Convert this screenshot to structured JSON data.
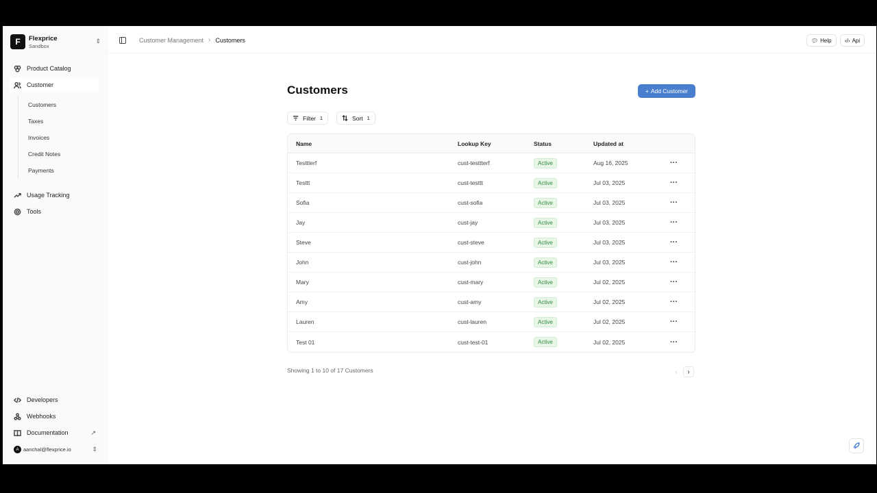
{
  "brand": {
    "initial": "F",
    "name": "Flexprice",
    "env": "Sandbox"
  },
  "nav": {
    "product_catalog": "Product Catalog",
    "customer": "Customer",
    "sub": [
      "Customers",
      "Taxes",
      "Invoices",
      "Credit Notes",
      "Payments"
    ],
    "usage_tracking": "Usage Tracking",
    "tools": "Tools",
    "developers": "Developers",
    "webhooks": "Webhooks",
    "documentation": "Documentation"
  },
  "user": {
    "initial": "A",
    "email": "aanchal@flexprice.io"
  },
  "breadcrumb": {
    "parent": "Customer Management",
    "current": "Customers"
  },
  "topbar": {
    "help": "Help",
    "api": "Api"
  },
  "page": {
    "title": "Customers",
    "add_label": "Add Customer",
    "filter_label": "Filter",
    "filter_count": "1",
    "sort_label": "Sort",
    "sort_count": "1"
  },
  "table": {
    "headers": [
      "Name",
      "Lookup Key",
      "Status",
      "Updated at"
    ],
    "rows": [
      {
        "name": "Testtterf",
        "key": "cust-testtterf",
        "status": "Active",
        "updated": "Aug 16, 2025"
      },
      {
        "name": "Testtt",
        "key": "cust-testtt",
        "status": "Active",
        "updated": "Jul 03, 2025"
      },
      {
        "name": "Sofia",
        "key": "cust-sofia",
        "status": "Active",
        "updated": "Jul 03, 2025"
      },
      {
        "name": "Jay",
        "key": "cust-jay",
        "status": "Active",
        "updated": "Jul 03, 2025"
      },
      {
        "name": "Steve",
        "key": "cust-steve",
        "status": "Active",
        "updated": "Jul 03, 2025"
      },
      {
        "name": "John",
        "key": "cust-john",
        "status": "Active",
        "updated": "Jul 03, 2025"
      },
      {
        "name": "Mary",
        "key": "cust-mary",
        "status": "Active",
        "updated": "Jul 02, 2025"
      },
      {
        "name": "Amy",
        "key": "cust-amy",
        "status": "Active",
        "updated": "Jul 02, 2025"
      },
      {
        "name": "Lauren",
        "key": "cust-lauren",
        "status": "Active",
        "updated": "Jul 02, 2025"
      },
      {
        "name": "Test 01",
        "key": "cust-test-01",
        "status": "Active",
        "updated": "Jul 02, 2025"
      }
    ]
  },
  "pagination": {
    "summary": "Showing 1 to 10 of 17 Customers"
  },
  "colors": {
    "accent": "#4a7fd0",
    "status_active": "#2f8a3a"
  }
}
